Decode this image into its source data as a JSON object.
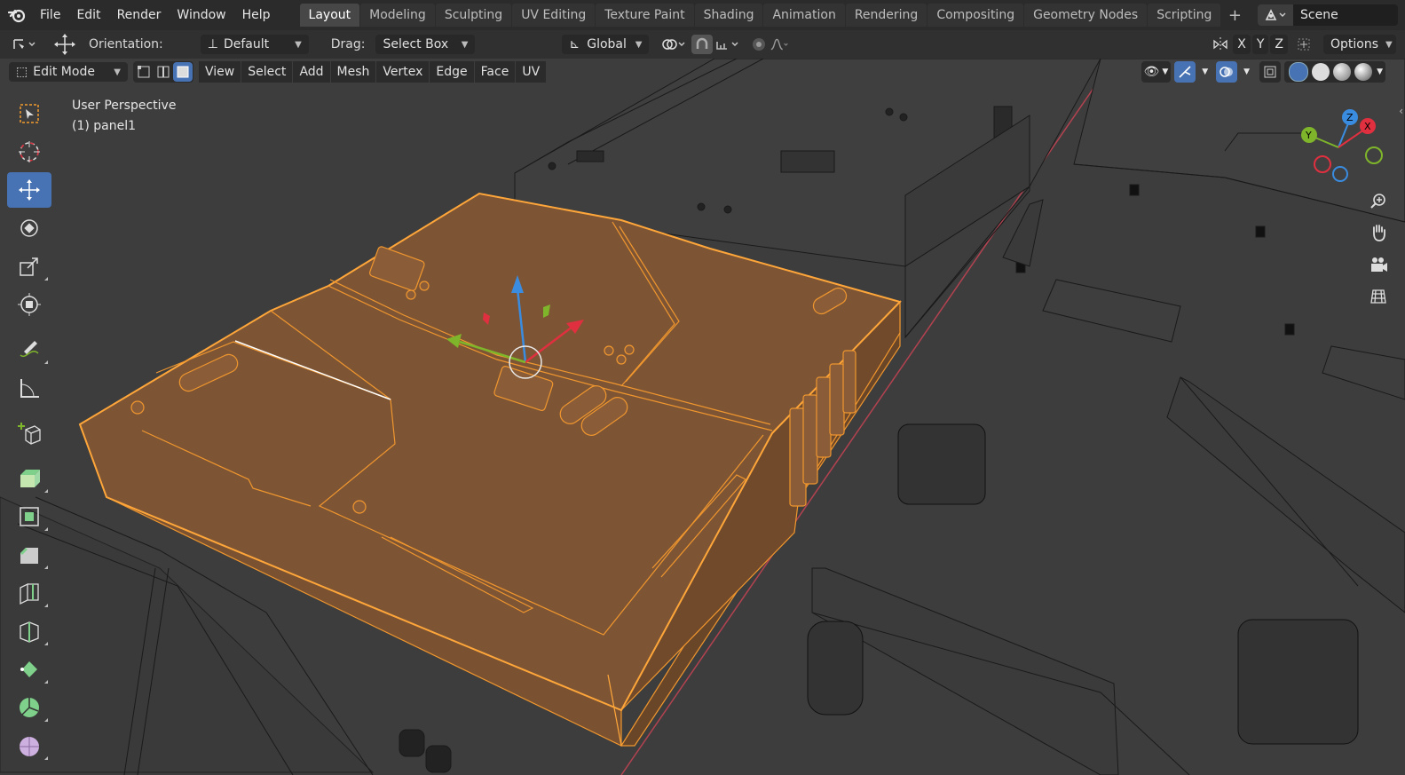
{
  "topbar": {
    "menus": [
      "File",
      "Edit",
      "Render",
      "Window",
      "Help"
    ],
    "workspaces": [
      {
        "label": "Layout",
        "active": true
      },
      {
        "label": "Modeling",
        "active": false
      },
      {
        "label": "Sculpting",
        "active": false
      },
      {
        "label": "UV Editing",
        "active": false
      },
      {
        "label": "Texture Paint",
        "active": false
      },
      {
        "label": "Shading",
        "active": false
      },
      {
        "label": "Animation",
        "active": false
      },
      {
        "label": "Rendering",
        "active": false
      },
      {
        "label": "Compositing",
        "active": false
      },
      {
        "label": "Geometry Nodes",
        "active": false
      },
      {
        "label": "Scripting",
        "active": false
      }
    ],
    "scene": "Scene"
  },
  "toolbar": {
    "orientation_label": "Orientation:",
    "orientation_value": "Default",
    "drag_label": "Drag:",
    "drag_value": "Select Box",
    "transform_orientation": "Global",
    "axes": [
      "X",
      "Y",
      "Z"
    ],
    "options": "Options"
  },
  "header": {
    "mode": "Edit Mode",
    "menus": [
      "View",
      "Select",
      "Add",
      "Mesh",
      "Vertex",
      "Edge",
      "Face",
      "UV"
    ]
  },
  "viewport": {
    "perspective": "User Perspective",
    "object": "(1) panel1"
  },
  "gizmo": {
    "x": "X",
    "y": "Y",
    "z": "Z"
  },
  "colors": {
    "selection": "#e8922c",
    "active_tool": "#4772b3",
    "x_axis": "#e0303f",
    "y_axis": "#7fb52a",
    "z_axis": "#3a8ce0"
  },
  "tools": [
    "select-box",
    "cursor",
    "move",
    "rotate",
    "scale",
    "transform",
    "annotate",
    "measure",
    "add-cube",
    "extrude",
    "inset",
    "bevel",
    "loop-cut",
    "knife",
    "poly-build",
    "spin",
    "smooth"
  ]
}
